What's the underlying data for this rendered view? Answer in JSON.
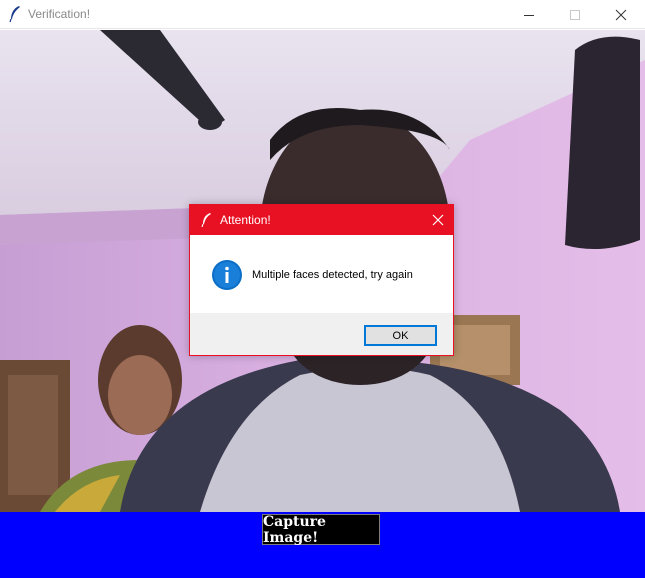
{
  "window": {
    "title": "Verification!",
    "icon": "feather-icon"
  },
  "dialog": {
    "title": "Attention!",
    "message": "Multiple faces detected, try again",
    "ok_label": "OK",
    "accent_color": "#e81123",
    "icon": "info-icon"
  },
  "capture": {
    "label": "Capture Image!",
    "bar_color": "#0000ff"
  }
}
